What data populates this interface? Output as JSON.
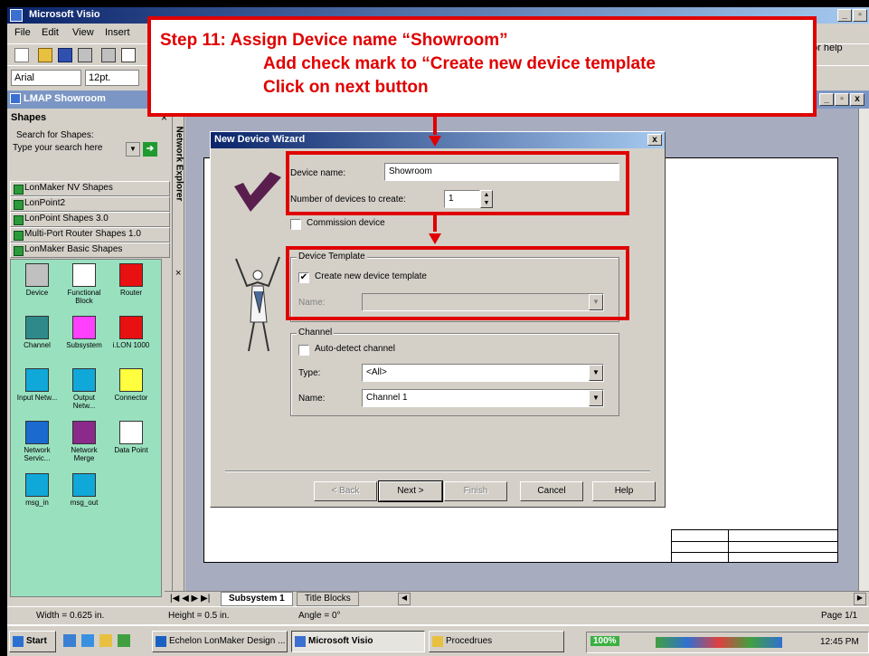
{
  "app": {
    "title": "Microsoft Visio",
    "help_placeholder": "or help"
  },
  "menu": [
    {
      "label": "File"
    },
    {
      "label": "Edit"
    },
    {
      "label": "View"
    },
    {
      "label": "Insert"
    }
  ],
  "toolbar": {
    "font": "Arial",
    "font_size": "12pt."
  },
  "document": {
    "title": "LMAP Showroom"
  },
  "shapes_panel": {
    "title": "Shapes",
    "search_label": "Search for Shapes:",
    "search_placeholder": "Type your search here",
    "stencils": [
      {
        "label": "LonMaker NV Shapes"
      },
      {
        "label": "LonPoint2"
      },
      {
        "label": "LonPoint Shapes 3.0"
      },
      {
        "label": "Multi-Port Router Shapes 1.0"
      },
      {
        "label": "LonMaker Basic Shapes"
      }
    ],
    "shapes": [
      {
        "label": "Device",
        "color": "#c0c0c0"
      },
      {
        "label": "Functional Block",
        "color": "#ffffff"
      },
      {
        "label": "Router",
        "color": "#e81010"
      },
      {
        "label": "Channel",
        "color": "#2e8a8a"
      },
      {
        "label": "Subsystem",
        "color": "#ff40ff"
      },
      {
        "label": "i.LON 1000",
        "color": "#e81010"
      },
      {
        "label": "Input Netw...",
        "color": "#10a8d8"
      },
      {
        "label": "Output Netw...",
        "color": "#10a8d8"
      },
      {
        "label": "Connector",
        "color": "#ffff40"
      },
      {
        "label": "Network Servic...",
        "color": "#1a6ad0"
      },
      {
        "label": "Network Merge",
        "color": "#8a2a8a"
      },
      {
        "label": "Data Point",
        "color": "#ffffff"
      },
      {
        "label": "msg_in",
        "color": "#10a8d8"
      },
      {
        "label": "msg_out",
        "color": "#10a8d8"
      }
    ]
  },
  "network_explorer": {
    "label": "Network Explorer"
  },
  "page_tabs": [
    {
      "label": "Subsystem 1"
    },
    {
      "label": "Title Blocks"
    }
  ],
  "status": {
    "width": "Width = 0.625 in.",
    "height": "Height = 0.5 in.",
    "angle": "Angle = 0°",
    "page": "Page 1/1"
  },
  "taskbar": {
    "start": "Start",
    "items": [
      {
        "label": "Echelon LonMaker Design ..."
      },
      {
        "label": "Microsoft Visio"
      },
      {
        "label": "Procedrues"
      }
    ],
    "zoom": "100%",
    "clock": "12:45 PM"
  },
  "dialog": {
    "title": "New Device Wizard",
    "device_name_label": "Device name:",
    "device_name_value": "Showroom",
    "num_devices_label": "Number of devices to create:",
    "num_devices_value": "1",
    "commission_label": "Commission device",
    "template_group": "Device Template",
    "create_template_label": "Create new device template",
    "template_name_label": "Name:",
    "template_name_value": "",
    "channel_group": "Channel",
    "auto_detect_label": "Auto-detect channel",
    "type_label": "Type:",
    "type_value": "<All>",
    "channel_name_label": "Name:",
    "channel_name_value": "Channel 1",
    "buttons": {
      "back": "< Back",
      "next": "Next >",
      "finish": "Finish",
      "cancel": "Cancel",
      "help": "Help"
    },
    "commission_checked": false,
    "create_template_checked": true,
    "auto_detect_checked": false
  },
  "annotation": {
    "line1": "Step 11: Assign Device name “Showroom”",
    "line2": "Add check mark to “Create new device template",
    "line3": "Click on next button",
    "color": "#e00000"
  }
}
